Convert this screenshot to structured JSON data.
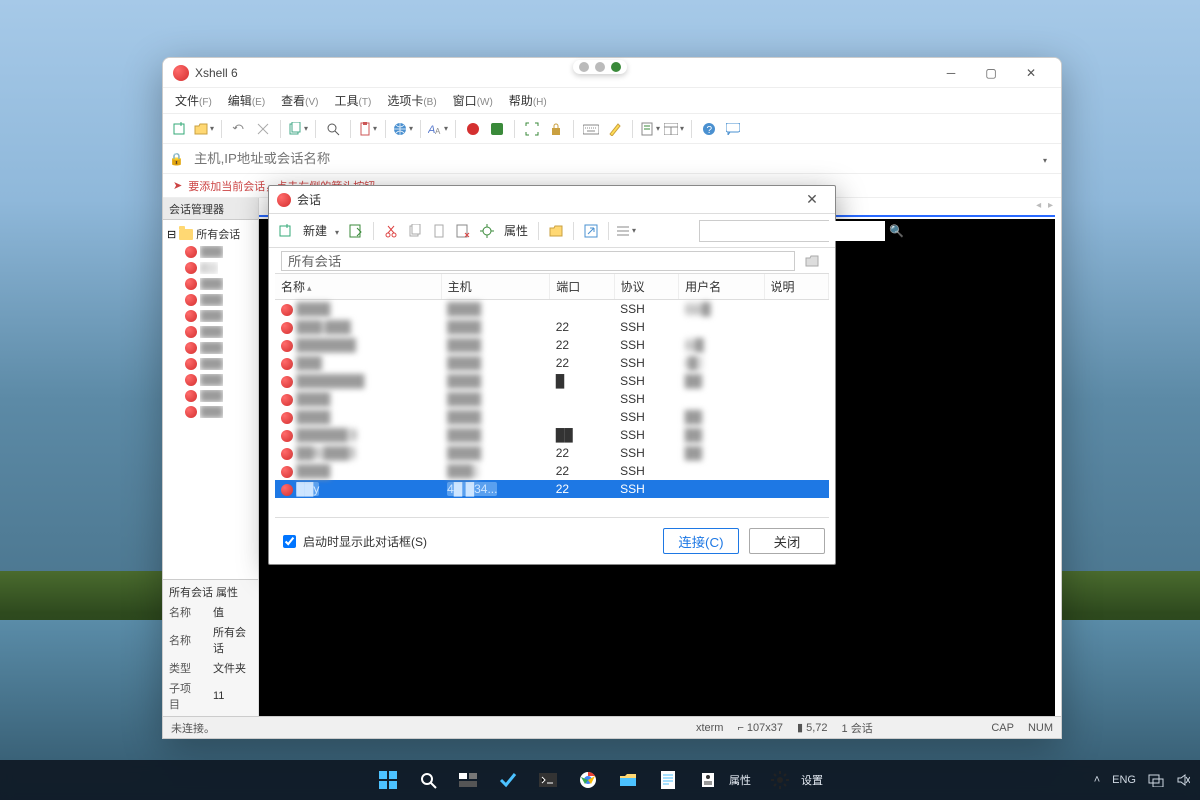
{
  "window": {
    "title": "Xshell 6",
    "menus": [
      {
        "label": "文件",
        "key": "(F)"
      },
      {
        "label": "编辑",
        "key": "(E)"
      },
      {
        "label": "查看",
        "key": "(V)"
      },
      {
        "label": "工具",
        "key": "(T)"
      },
      {
        "label": "选项卡",
        "key": "(B)"
      },
      {
        "label": "窗口",
        "key": "(W)"
      },
      {
        "label": "帮助",
        "key": "(H)"
      }
    ],
    "address_placeholder": "主机,IP地址或会话名称",
    "hint_text": "要添加当前会话，点击左侧的箭头按钮。"
  },
  "session_manager": {
    "header": "会话管理器",
    "root_label": "所有会话",
    "items": [
      {
        "label": ""
      },
      {
        "label": "2"
      },
      {
        "label": ""
      },
      {
        "label": ""
      },
      {
        "label": ""
      },
      {
        "label": ""
      },
      {
        "label": ""
      },
      {
        "label": ""
      },
      {
        "label": ""
      },
      {
        "label": ""
      },
      {
        "label": ""
      }
    ],
    "props_header": "所有会话 属性",
    "props": {
      "col_a": "名称",
      "col_b": "值",
      "rows": [
        {
          "k": "名称",
          "v": "所有会话"
        },
        {
          "k": "类型",
          "v": "文件夹"
        },
        {
          "k": "子项目",
          "v": "11"
        }
      ]
    }
  },
  "dialog": {
    "title": "会话",
    "toolbar": {
      "new_label": "新建",
      "props_label": "属性"
    },
    "path_value": "所有会话",
    "columns": {
      "name": "名称",
      "host": "主机",
      "port": "端口",
      "proto": "协议",
      "user": "用户名",
      "desc": "说明"
    },
    "rows": [
      {
        "name": "████",
        "host": "████",
        "port": "",
        "proto": "SSH",
        "user": "roo█",
        "sel": false
      },
      {
        "name": "███.███",
        "host": "████",
        "port": "22",
        "proto": "SSH",
        "user": "",
        "sel": false
      },
      {
        "name": "███████",
        "host": "████",
        "port": "22",
        "proto": "SSH",
        "user": "ro█",
        "sel": false
      },
      {
        "name": "███",
        "host": "████",
        "port": "22",
        "proto": "SSH",
        "user": "r█",
        "sel": false
      },
      {
        "name": "████████",
        "host": "████",
        "port": "█",
        "proto": "SSH",
        "user": "██",
        "sel": false
      },
      {
        "name": "████",
        "host": "████",
        "port": "",
        "proto": "SSH",
        "user": "",
        "sel": false
      },
      {
        "name": "████",
        "host": "████",
        "port": "",
        "proto": "SSH",
        "user": "██",
        "sel": false
      },
      {
        "name": "██████ 9",
        "host": "████",
        "port": "██",
        "proto": "SSH",
        "user": "██",
        "sel": false
      },
      {
        "name": "██6.███3",
        "host": "████",
        "port": "22",
        "proto": "SSH",
        "user": "██",
        "sel": false
      },
      {
        "name": "████",
        "host": "███..",
        "port": "22",
        "proto": "SSH",
        "user": "",
        "sel": false
      },
      {
        "name": "██y",
        "host": "4█ █34...",
        "port": "22",
        "proto": "SSH",
        "user": "",
        "sel": true
      }
    ],
    "footer": {
      "startup_label": "启动时显示此对话框(S)",
      "connect": "连接(C)",
      "close": "关闭"
    }
  },
  "statusbar": {
    "left": "未连接。",
    "term": "xterm",
    "size": "107x37",
    "cursor": "5,72",
    "sess": "1 会话",
    "cap": "CAP",
    "num": "NUM"
  },
  "taskbar": {
    "items": [
      {
        "name": "start-icon"
      },
      {
        "name": "search-icon"
      },
      {
        "name": "taskview-icon"
      },
      {
        "name": "check-icon"
      },
      {
        "name": "terminal-icon"
      },
      {
        "name": "chrome-icon"
      },
      {
        "name": "explorer-icon"
      },
      {
        "name": "notes-icon"
      },
      {
        "name_label": "属性",
        "name": "props-icon"
      },
      {
        "name_label": "设置",
        "name": "settings-icon"
      }
    ],
    "tray": {
      "lang": "ENG"
    }
  }
}
